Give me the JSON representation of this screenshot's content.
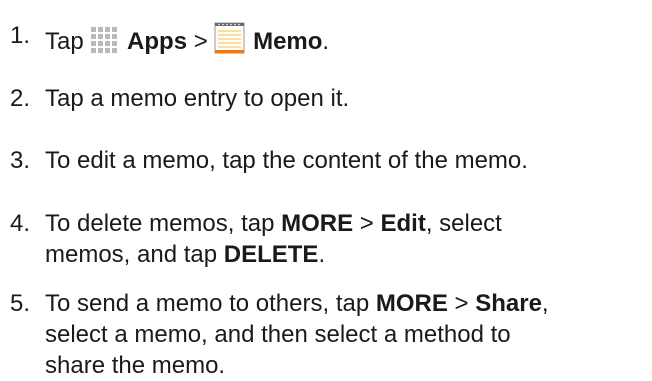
{
  "steps": [
    {
      "number": "1.",
      "tap": "Tap",
      "apps": "Apps",
      "sep": ">",
      "memo": "Memo",
      "end": ".",
      "icons": [
        "apps-grid-icon",
        "memo-notepad-icon"
      ]
    },
    {
      "number": "2.",
      "text": "Tap a memo entry to open it."
    },
    {
      "number": "3.",
      "text": "To edit a memo, tap the content of the memo."
    },
    {
      "number": "4.",
      "line1_a": "To delete memos, tap",
      "line1_more": "MORE",
      "line1_sep": ">",
      "line1_edit": "Edit",
      "line1_b": ", select",
      "line2_a": "memos, and tap",
      "line2_delete": "DELETE",
      "line2_end": "."
    },
    {
      "number": "5.",
      "line1_a": "To send a memo to others, tap",
      "line1_more": "MORE",
      "line1_sep": ">",
      "line1_share": "Share",
      "line1_end": ",",
      "line2": "select a memo, and then select a method to",
      "line3": "share the memo."
    }
  ],
  "colors": {
    "text": "#1a1a1a",
    "icon_grid": "#b8b8b8",
    "memo_accent": "#e87a1e",
    "memo_lines": "#f0c060"
  }
}
